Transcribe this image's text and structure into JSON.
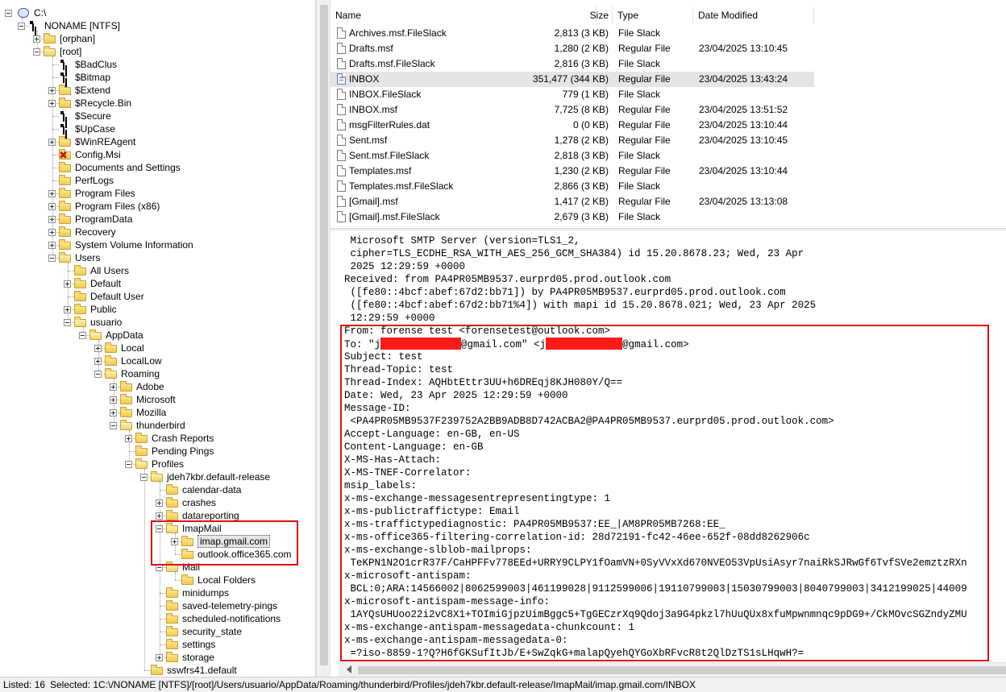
{
  "tree": {
    "nodes": [
      {
        "label": "C:\\",
        "icon": "drive-icon",
        "level": 0,
        "expander": "minus"
      },
      {
        "label": "NONAME [NTFS]",
        "icon": "volume-icon",
        "level": 1,
        "expander": "minus"
      },
      {
        "label": "[orphan]",
        "icon": "folder-icon",
        "level": 2,
        "expander": "plus"
      },
      {
        "label": "[root]",
        "icon": "folder-icon",
        "level": 2,
        "expander": "minus"
      },
      {
        "label": "$BadClus",
        "icon": "system-file-icon",
        "level": 3,
        "expander": "none"
      },
      {
        "label": "$Bitmap",
        "icon": "system-file-icon",
        "level": 3,
        "expander": "none"
      },
      {
        "label": "$Extend",
        "icon": "folder-icon",
        "level": 3,
        "expander": "plus"
      },
      {
        "label": "$Recycle.Bin",
        "icon": "folder-icon",
        "level": 3,
        "expander": "plus"
      },
      {
        "label": "$Secure",
        "icon": "system-file-icon",
        "level": 3,
        "expander": "none"
      },
      {
        "label": "$UpCase",
        "icon": "system-file-icon",
        "level": 3,
        "expander": "none"
      },
      {
        "label": "$WinREAgent",
        "icon": "folder-icon",
        "level": 3,
        "expander": "plus"
      },
      {
        "label": "Config.Msi",
        "icon": "deleted-folder-icon",
        "level": 3,
        "expander": "none"
      },
      {
        "label": "Documents and Settings",
        "icon": "folder-icon",
        "level": 3,
        "expander": "none"
      },
      {
        "label": "PerfLogs",
        "icon": "folder-icon",
        "level": 3,
        "expander": "none"
      },
      {
        "label": "Program Files",
        "icon": "folder-icon",
        "level": 3,
        "expander": "plus"
      },
      {
        "label": "Program Files (x86)",
        "icon": "folder-icon",
        "level": 3,
        "expander": "plus"
      },
      {
        "label": "ProgramData",
        "icon": "folder-icon",
        "level": 3,
        "expander": "plus"
      },
      {
        "label": "Recovery",
        "icon": "folder-icon",
        "level": 3,
        "expander": "plus"
      },
      {
        "label": "System Volume Information",
        "icon": "folder-icon",
        "level": 3,
        "expander": "plus"
      },
      {
        "label": "Users",
        "icon": "folder-icon",
        "level": 3,
        "expander": "minus"
      },
      {
        "label": "All Users",
        "icon": "folder-icon",
        "level": 4,
        "expander": "none"
      },
      {
        "label": "Default",
        "icon": "folder-icon",
        "level": 4,
        "expander": "plus"
      },
      {
        "label": "Default User",
        "icon": "folder-icon",
        "level": 4,
        "expander": "none"
      },
      {
        "label": "Public",
        "icon": "folder-icon",
        "level": 4,
        "expander": "plus"
      },
      {
        "label": "usuario",
        "icon": "folder-icon",
        "level": 4,
        "expander": "minus"
      },
      {
        "label": "AppData",
        "icon": "folder-icon",
        "level": 5,
        "expander": "minus"
      },
      {
        "label": "Local",
        "icon": "folder-icon",
        "level": 6,
        "expander": "plus"
      },
      {
        "label": "LocalLow",
        "icon": "folder-icon",
        "level": 6,
        "expander": "plus"
      },
      {
        "label": "Roaming",
        "icon": "folder-icon",
        "level": 6,
        "expander": "minus"
      },
      {
        "label": "Adobe",
        "icon": "folder-icon",
        "level": 7,
        "expander": "plus"
      },
      {
        "label": "Microsoft",
        "icon": "folder-icon",
        "level": 7,
        "expander": "plus"
      },
      {
        "label": "Mozilla",
        "icon": "folder-icon",
        "level": 7,
        "expander": "plus"
      },
      {
        "label": "thunderbird",
        "icon": "folder-icon",
        "level": 7,
        "expander": "minus"
      },
      {
        "label": "Crash Reports",
        "icon": "folder-icon",
        "level": 8,
        "expander": "plus"
      },
      {
        "label": "Pending Pings",
        "icon": "folder-icon",
        "level": 8,
        "expander": "none"
      },
      {
        "label": "Profiles",
        "icon": "folder-icon",
        "level": 8,
        "expander": "minus"
      },
      {
        "label": "jdeh7kbr.default-release",
        "icon": "folder-icon",
        "level": 9,
        "expander": "minus"
      },
      {
        "label": "calendar-data",
        "icon": "folder-icon",
        "level": 10,
        "expander": "none"
      },
      {
        "label": "crashes",
        "icon": "folder-icon",
        "level": 10,
        "expander": "plus"
      },
      {
        "label": "datareporting",
        "icon": "folder-icon",
        "level": 10,
        "expander": "plus"
      },
      {
        "label": "ImapMail",
        "icon": "folder-icon",
        "level": 10,
        "expander": "minus"
      },
      {
        "label": "imap.gmail.com",
        "icon": "folder-icon",
        "level": 11,
        "expander": "plus",
        "selected": true
      },
      {
        "label": "outlook.office365.com",
        "icon": "folder-icon",
        "level": 11,
        "expander": "none"
      },
      {
        "label": "Mail",
        "icon": "folder-icon",
        "level": 10,
        "expander": "minus"
      },
      {
        "label": "Local Folders",
        "icon": "folder-icon",
        "level": 11,
        "expander": "none"
      },
      {
        "label": "minidumps",
        "icon": "folder-icon",
        "level": 10,
        "expander": "none"
      },
      {
        "label": "saved-telemetry-pings",
        "icon": "folder-icon",
        "level": 10,
        "expander": "none"
      },
      {
        "label": "scheduled-notifications",
        "icon": "folder-icon",
        "level": 10,
        "expander": "none"
      },
      {
        "label": "security_state",
        "icon": "folder-icon",
        "level": 10,
        "expander": "none"
      },
      {
        "label": "settings",
        "icon": "folder-icon",
        "level": 10,
        "expander": "none"
      },
      {
        "label": "storage",
        "icon": "folder-icon",
        "level": 10,
        "expander": "plus"
      },
      {
        "label": "sswfrs41.default",
        "icon": "folder-icon",
        "level": 9,
        "expander": "none"
      }
    ]
  },
  "file_list": {
    "columns": {
      "name": "Name",
      "size": "Size",
      "type": "Type",
      "modified": "Date Modified"
    },
    "rows": [
      {
        "name": "Archives.msf.FileSlack",
        "size": "2,813 (3 KB)",
        "type": "File Slack",
        "modified": "",
        "icon": "file-icon"
      },
      {
        "name": "Drafts.msf",
        "size": "1,280 (2 KB)",
        "type": "Regular File",
        "modified": "23/04/2025 13:10:45",
        "icon": "file-icon"
      },
      {
        "name": "Drafts.msf.FileSlack",
        "size": "2,816 (3 KB)",
        "type": "File Slack",
        "modified": "",
        "icon": "file-icon"
      },
      {
        "name": "INBOX",
        "size": "351,477 (344 KB)",
        "type": "Regular File",
        "modified": "23/04/2025 13:43:24",
        "icon": "mail-file-icon",
        "selected": true
      },
      {
        "name": "INBOX.FileSlack",
        "size": "779 (1 KB)",
        "type": "File Slack",
        "modified": "",
        "icon": "file-icon"
      },
      {
        "name": "INBOX.msf",
        "size": "7,725 (8 KB)",
        "type": "Regular File",
        "modified": "23/04/2025 13:51:52",
        "icon": "file-icon"
      },
      {
        "name": "msgFilterRules.dat",
        "size": "0 (0 KB)",
        "type": "Regular File",
        "modified": "23/04/2025 13:10:44",
        "icon": "file-icon"
      },
      {
        "name": "Sent.msf",
        "size": "1,278 (2 KB)",
        "type": "Regular File",
        "modified": "23/04/2025 13:10:45",
        "icon": "file-icon"
      },
      {
        "name": "Sent.msf.FileSlack",
        "size": "2,818 (3 KB)",
        "type": "File Slack",
        "modified": "",
        "icon": "file-icon"
      },
      {
        "name": "Templates.msf",
        "size": "1,230 (2 KB)",
        "type": "Regular File",
        "modified": "23/04/2025 13:10:44",
        "icon": "file-icon"
      },
      {
        "name": "Templates.msf.FileSlack",
        "size": "2,866 (3 KB)",
        "type": "File Slack",
        "modified": "",
        "icon": "file-icon"
      },
      {
        "name": "[Gmail].msf",
        "size": "1,417 (2 KB)",
        "type": "Regular File",
        "modified": "23/04/2025 13:13:08",
        "icon": "file-icon"
      },
      {
        "name": "[Gmail].msf.FileSlack",
        "size": "2,679 (3 KB)",
        "type": "File Slack",
        "modified": "",
        "icon": "file-icon"
      }
    ]
  },
  "preview": {
    "lines": [
      " Microsoft SMTP Server (version=TLS1_2,",
      " cipher=TLS_ECDHE_RSA_WITH_AES_256_GCM_SHA384) id 15.20.8678.23; Wed, 23 Apr",
      " 2025 12:29:59 +0000",
      "Received: from PA4PR05MB9537.eurprd05.prod.outlook.com",
      " ([fe80::4bcf:abef:67d2:bb71]) by PA4PR05MB9537.eurprd05.prod.outlook.com",
      " ([fe80::4bcf:abef:67d2:bb71%4]) with mapi id 15.20.8678.021; Wed, 23 Apr 2025",
      " 12:29:59 +0000",
      "From: forense test <forensetest@outlook.com>",
      "TO_LINE",
      "Subject: test",
      "Thread-Topic: test",
      "Thread-Index: AQHbtEttr3UU+h6DREqj8KJH080Y/Q==",
      "Date: Wed, 23 Apr 2025 12:29:59 +0000",
      "Message-ID:",
      " <PA4PR05MB9537F239752A2BB9ADB8D742ACBA2@PA4PR05MB9537.eurprd05.prod.outlook.com>",
      "Accept-Language: en-GB, en-US",
      "Content-Language: en-GB",
      "X-MS-Has-Attach:",
      "X-MS-TNEF-Correlator:",
      "msip_labels:",
      "x-ms-exchange-messagesentrepresentingtype: 1",
      "x-ms-publictraffictype: Email",
      "x-ms-traffictypediagnostic: PA4PR05MB9537:EE_|AM8PR05MB7268:EE_",
      "x-ms-office365-filtering-correlation-id: 28d72191-fc42-46ee-652f-08dd8262906c",
      "x-ms-exchange-slblob-mailprops:",
      " TeKPN1N2O1crR37F/CaHPFFv778EEd+URRY9CLPY1fOamVN+0SyVVxXd670NVEO53VpUsiAsyr7naiRkSJRwGf6TvfSVe2emztzRXn",
      "x-microsoft-antispam:",
      " BCL:0;ARA:14566002|8062599003|461199028|9112599006|19110799003|15030799003|8040799003|3412199025|44009",
      "x-microsoft-antispam-message-info:",
      " 1AYQsUHUoo22i2vC8X1+TOImiGjpzUimBggc5+TgGECzrXq9Qdoj3a9G4pkzl7hUuQUx8xfuMpwnmnqc9pDG9+/CkMOvcSGZndyZMU",
      "x-ms-exchange-antispam-messagedata-chunkcount: 1",
      "x-ms-exchange-antispam-messagedata-0:",
      " =?iso-8859-1?Q?H6fGKSufItJb/E+SwZqkG+malapQyehQYGoXbRFvcR8t2QlDzTS1sLHqwH?="
    ],
    "to_line": {
      "prefix": "To: \"",
      "part1_start": "j",
      "part1_end": "@gmail.com\" <j",
      "suffix": "@gmail.com>"
    },
    "redaction_color": "#ff1a1a",
    "highlight_color": "#e01010"
  },
  "status": {
    "listed": "Listed: 16",
    "selected": "Selected: 1",
    "path": "C:\\/NONAME [NTFS]/[root]/Users/usuario/AppData/Roaming/thunderbird/Profiles/jdeh7kbr.default-release/ImapMail/imap.gmail.com/INBOX"
  }
}
